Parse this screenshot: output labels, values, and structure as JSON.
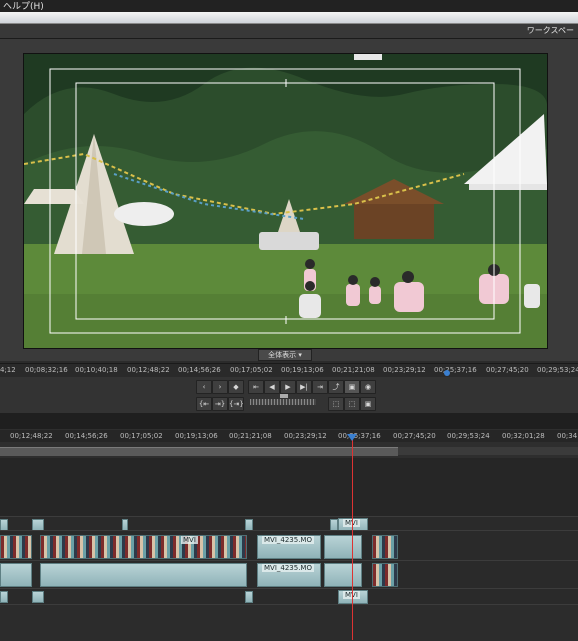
{
  "menu": {
    "help": "ヘルプ(H)"
  },
  "workspace_label": "ワークスペー",
  "monitor": {
    "zoom_label": "全体表示"
  },
  "monitor_ruler": {
    "ticks": [
      "4;12",
      "00;08;32;16",
      "00;10;40;18",
      "00;12;48;22",
      "00;14;56;26",
      "00;17;05;02",
      "00;19;13;06",
      "00;21;21;08",
      "00;23;29;12",
      "00;25;37;16",
      "00;27;45;20",
      "00;29;53;24"
    ]
  },
  "transport": {
    "row1": [
      "‹",
      "›",
      "◆",
      "⇤",
      "◀",
      "▶",
      "▶|",
      "⇥",
      "⤴",
      "▣",
      "◉"
    ],
    "row2": [
      "{⇤",
      "⇥}",
      "{⇥}",
      "⬚",
      "⬚",
      "▣"
    ]
  },
  "timeline_ruler": {
    "ticks": [
      "00;12;48;22",
      "00;14;56;26",
      "00;17;05;02",
      "00;19;13;06",
      "00;21;21;08",
      "00;23;29;12",
      "00;25;37;16",
      "00;27;45;20",
      "00;29;53;24",
      "00;32;01;28",
      "00;34"
    ]
  },
  "clips": {
    "label_a": "MVI_4235.MO",
    "label_b": "MVI_4235.MO",
    "label_c": "MVI",
    "label_d": "MVI",
    "label_e": "MVI"
  }
}
